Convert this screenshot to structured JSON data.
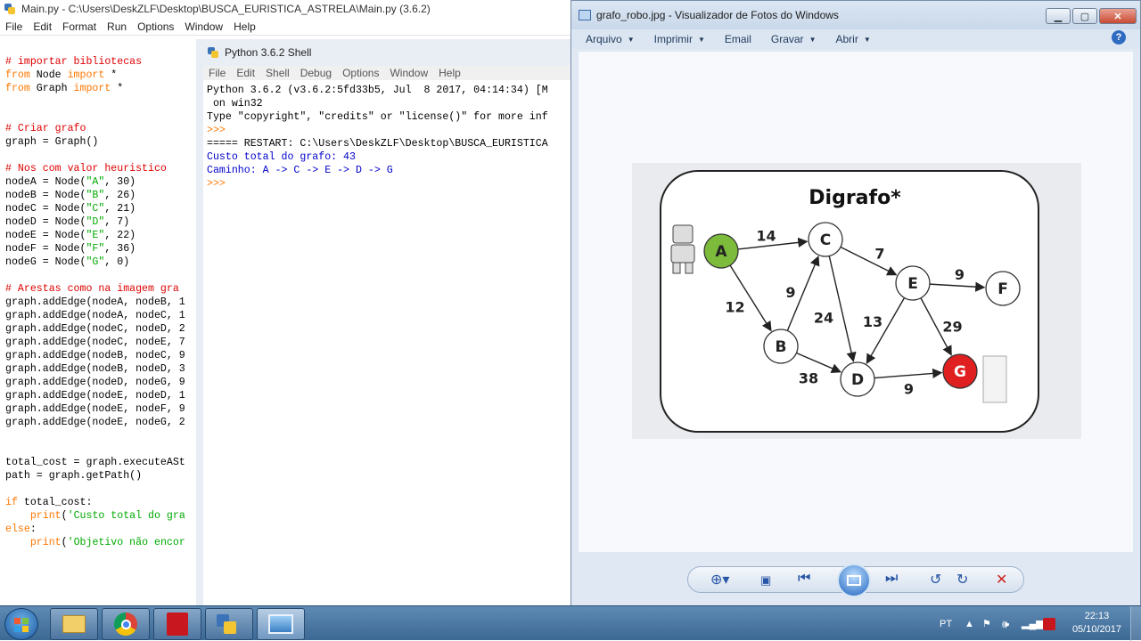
{
  "editor": {
    "title": "Main.py - C:\\Users\\DeskZLF\\Desktop\\BUSCA_EURISTICA_ASTRELA\\Main.py (3.6.2)",
    "menu": [
      "File",
      "Edit",
      "Format",
      "Run",
      "Options",
      "Window",
      "Help"
    ],
    "code_lines": [
      [
        {
          "t": "# importar bibliotecas",
          "c": "comment"
        }
      ],
      [
        {
          "t": "from",
          "c": "kw"
        },
        {
          "t": " Node ",
          "c": "def"
        },
        {
          "t": "import",
          "c": "kw"
        },
        {
          "t": " *",
          "c": "def"
        }
      ],
      [
        {
          "t": "from",
          "c": "kw"
        },
        {
          "t": " Graph ",
          "c": "def"
        },
        {
          "t": "import",
          "c": "kw"
        },
        {
          "t": " *",
          "c": "def"
        }
      ],
      [],
      [],
      [
        {
          "t": "# Criar grafo",
          "c": "comment"
        }
      ],
      [
        {
          "t": "graph = Graph()",
          "c": "def"
        }
      ],
      [],
      [
        {
          "t": "# Nos com valor heuristico",
          "c": "comment"
        }
      ],
      [
        {
          "t": "nodeA = Node(",
          "c": "def"
        },
        {
          "t": "\"A\"",
          "c": "str"
        },
        {
          "t": ", 30)",
          "c": "def"
        }
      ],
      [
        {
          "t": "nodeB = Node(",
          "c": "def"
        },
        {
          "t": "\"B\"",
          "c": "str"
        },
        {
          "t": ", 26)",
          "c": "def"
        }
      ],
      [
        {
          "t": "nodeC = Node(",
          "c": "def"
        },
        {
          "t": "\"C\"",
          "c": "str"
        },
        {
          "t": ", 21)",
          "c": "def"
        }
      ],
      [
        {
          "t": "nodeD = Node(",
          "c": "def"
        },
        {
          "t": "\"D\"",
          "c": "str"
        },
        {
          "t": ", 7)",
          "c": "def"
        }
      ],
      [
        {
          "t": "nodeE = Node(",
          "c": "def"
        },
        {
          "t": "\"E\"",
          "c": "str"
        },
        {
          "t": ", 22)",
          "c": "def"
        }
      ],
      [
        {
          "t": "nodeF = Node(",
          "c": "def"
        },
        {
          "t": "\"F\"",
          "c": "str"
        },
        {
          "t": ", 36)",
          "c": "def"
        }
      ],
      [
        {
          "t": "nodeG = Node(",
          "c": "def"
        },
        {
          "t": "\"G\"",
          "c": "str"
        },
        {
          "t": ", 0)",
          "c": "def"
        }
      ],
      [],
      [
        {
          "t": "# Arestas como na imagem gra",
          "c": "comment"
        }
      ],
      [
        {
          "t": "graph.addEdge(nodeA, nodeB, 1",
          "c": "def"
        }
      ],
      [
        {
          "t": "graph.addEdge(nodeA, nodeC, 1",
          "c": "def"
        }
      ],
      [
        {
          "t": "graph.addEdge(nodeC, nodeD, 2",
          "c": "def"
        }
      ],
      [
        {
          "t": "graph.addEdge(nodeC, nodeE, 7",
          "c": "def"
        }
      ],
      [
        {
          "t": "graph.addEdge(nodeB, nodeC, 9",
          "c": "def"
        }
      ],
      [
        {
          "t": "graph.addEdge(nodeB, nodeD, 3",
          "c": "def"
        }
      ],
      [
        {
          "t": "graph.addEdge(nodeD, nodeG, 9",
          "c": "def"
        }
      ],
      [
        {
          "t": "graph.addEdge(nodeE, nodeD, 1",
          "c": "def"
        }
      ],
      [
        {
          "t": "graph.addEdge(nodeE, nodeF, 9",
          "c": "def"
        }
      ],
      [
        {
          "t": "graph.addEdge(nodeE, nodeG, 2",
          "c": "def"
        }
      ],
      [],
      [],
      [
        {
          "t": "total_cost = graph.executeASt",
          "c": "def"
        }
      ],
      [
        {
          "t": "path = graph.getPath()",
          "c": "def"
        }
      ],
      [],
      [
        {
          "t": "if",
          "c": "kw"
        },
        {
          "t": " total_cost:",
          "c": "def"
        }
      ],
      [
        {
          "t": "    ",
          "c": "def"
        },
        {
          "t": "print",
          "c": "kw"
        },
        {
          "t": "(",
          "c": "def"
        },
        {
          "t": "'Custo total do gra",
          "c": "str"
        }
      ],
      [
        {
          "t": "else",
          "c": "kw"
        },
        {
          "t": ":",
          "c": "def"
        }
      ],
      [
        {
          "t": "    ",
          "c": "def"
        },
        {
          "t": "print",
          "c": "kw"
        },
        {
          "t": "(",
          "c": "def"
        },
        {
          "t": "'Objetivo não encor",
          "c": "str"
        }
      ]
    ]
  },
  "shell": {
    "title": "Python 3.6.2 Shell",
    "menu": [
      "File",
      "Edit",
      "Shell",
      "Debug",
      "Options",
      "Window",
      "Help"
    ],
    "lines": [
      {
        "t": "Python 3.6.2 (v3.6.2:5fd33b5, Jul  8 2017, 04:14:34) [M",
        "c": "def"
      },
      {
        "t": " on win32",
        "c": "def"
      },
      {
        "t": "Type \"copyright\", \"credits\" or \"license()\" for more inf",
        "c": "def"
      },
      {
        "t": ">>>",
        "c": "kw"
      },
      {
        "t": "===== RESTART: C:\\Users\\DeskZLF\\Desktop\\BUSCA_EURISTICA",
        "c": "def"
      },
      {
        "t": "Custo total do grafo: 43",
        "c": "out"
      },
      {
        "t": "Caminho: A -> C -> E -> D -> G",
        "c": "out"
      },
      {
        "t": ">>>",
        "c": "kw"
      }
    ]
  },
  "viewer": {
    "title": "grafo_robo.jpg - Visualizador de Fotos do Windows",
    "toolbar": [
      "Arquivo",
      "Imprimir",
      "Email",
      "Gravar",
      "Abrir"
    ],
    "toolbar_has_caret": [
      true,
      true,
      false,
      true,
      true
    ],
    "graph": {
      "title": "Digrafo*",
      "nodes": [
        {
          "id": "A",
          "fill": "#7dbb3c"
        },
        {
          "id": "B",
          "fill": "#ffffff"
        },
        {
          "id": "C",
          "fill": "#ffffff"
        },
        {
          "id": "D",
          "fill": "#ffffff"
        },
        {
          "id": "E",
          "fill": "#ffffff"
        },
        {
          "id": "F",
          "fill": "#ffffff"
        },
        {
          "id": "G",
          "fill": "#e02020"
        }
      ],
      "edges": [
        {
          "from": "A",
          "to": "C",
          "w": "14"
        },
        {
          "from": "A",
          "to": "B",
          "w": "12"
        },
        {
          "from": "B",
          "to": "C",
          "w": "9"
        },
        {
          "from": "B",
          "to": "D",
          "w": "38"
        },
        {
          "from": "C",
          "to": "E",
          "w": "7"
        },
        {
          "from": "C",
          "to": "D",
          "w": "24"
        },
        {
          "from": "E",
          "to": "F",
          "w": "9"
        },
        {
          "from": "E",
          "to": "D",
          "w": "13"
        },
        {
          "from": "E",
          "to": "G",
          "w": "29"
        },
        {
          "from": "D",
          "to": "G",
          "w": "9"
        }
      ]
    }
  },
  "taskbar": {
    "language": "PT",
    "time": "22:13",
    "date": "05/10/2017"
  },
  "colors": {
    "accent": "#2856a6",
    "node_start": "#7dbb3c",
    "node_goal": "#e02020"
  }
}
